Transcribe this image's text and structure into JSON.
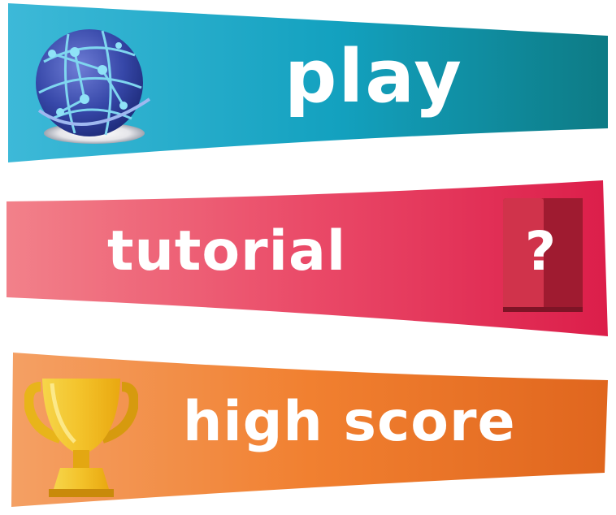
{
  "menu": {
    "play_label": "play",
    "tutorial_label": "tutorial",
    "high_score_label": "high score",
    "tutorial_icon_glyph": "?"
  },
  "icons": {
    "play": "globe-network-icon",
    "tutorial": "help-book-icon",
    "high_score": "trophy-icon"
  },
  "colors": {
    "play_banner_start": "#3db7d6",
    "play_banner_end": "#0e7c86",
    "tutorial_banner_start": "#f27f86",
    "tutorial_banner_end": "#e02650",
    "high_score_banner_start": "#f39a56",
    "high_score_banner_end": "#e56a1f",
    "label_text": "#ffffff"
  }
}
